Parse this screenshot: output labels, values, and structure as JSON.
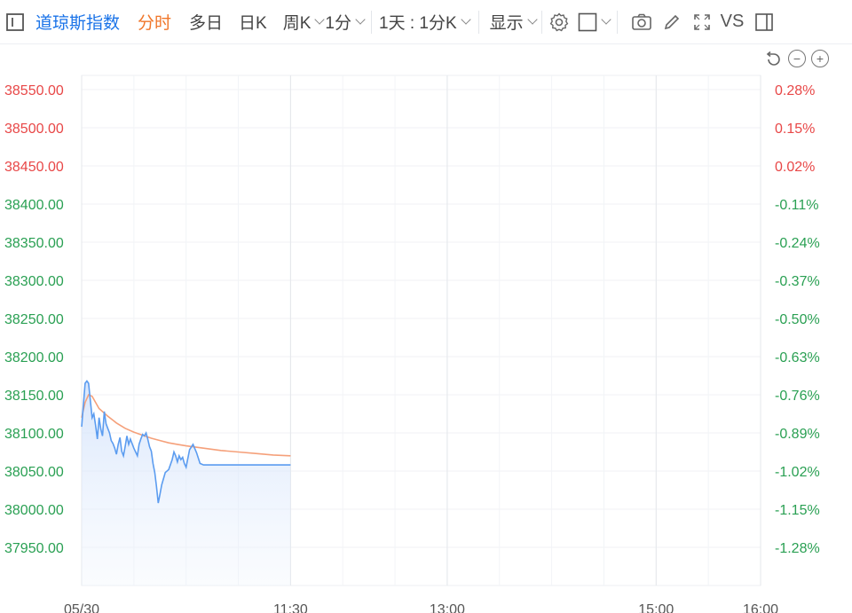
{
  "toolbar": {
    "symbol": "道琼斯指数",
    "tabs": [
      {
        "label": "分时",
        "active": true
      },
      {
        "label": "多日",
        "active": false
      },
      {
        "label": "日K",
        "active": false
      },
      {
        "label": "周K",
        "active": false
      }
    ],
    "interval": "1分",
    "range": "1天 : 1分K",
    "display": "显示",
    "vs": "VS"
  },
  "colors": {
    "accent": "#1a73e8",
    "active_tab": "#f0762a",
    "up": "#e84747",
    "down": "#2aa053",
    "price_line": "#5b9cf0",
    "avg_line": "#f5a07a"
  },
  "chart_data": {
    "type": "line",
    "y_left_ticks": [
      "38550.00",
      "38500.00",
      "38450.00",
      "38400.00",
      "38350.00",
      "38300.00",
      "38250.00",
      "38200.00",
      "38150.00",
      "38100.00",
      "38050.00",
      "38000.00",
      "37950.00"
    ],
    "y_right_ticks": [
      "0.28%",
      "0.15%",
      "0.02%",
      "-0.11%",
      "-0.24%",
      "-0.37%",
      "-0.50%",
      "-0.63%",
      "-0.76%",
      "-0.89%",
      "-1.02%",
      "-1.15%",
      "-1.28%"
    ],
    "right_tick_up": [
      true,
      true,
      true,
      false,
      false,
      false,
      false,
      false,
      false,
      false,
      false,
      false,
      false
    ],
    "ylim": [
      37950,
      38550
    ],
    "x_ticks": [
      {
        "label": "05/30",
        "t": 0
      },
      {
        "label": "11:30",
        "t": 120
      },
      {
        "label": "13:00",
        "t": 210
      },
      {
        "label": "15:00",
        "t": 330
      },
      {
        "label": "16:00",
        "t": 390
      }
    ],
    "x_range": [
      0,
      390
    ],
    "series": [
      {
        "role": "price",
        "x": [
          0,
          2,
          3,
          4,
          6,
          7,
          8,
          9,
          10,
          11,
          12,
          13,
          14,
          15,
          16,
          17,
          18,
          19,
          20,
          21,
          22,
          23,
          24,
          25,
          26,
          27,
          28,
          30,
          32,
          33,
          34,
          35,
          36,
          37,
          38,
          39,
          40,
          41,
          42,
          43,
          44,
          45,
          46,
          47,
          48,
          50,
          52,
          53,
          54,
          55,
          56,
          57,
          58,
          59,
          60,
          62,
          64,
          66,
          68,
          70,
          80,
          90,
          100,
          110,
          120
        ],
        "y": [
          38108,
          38165,
          38168,
          38165,
          38120,
          38125,
          38110,
          38092,
          38120,
          38105,
          38096,
          38128,
          38112,
          38106,
          38100,
          38090,
          38086,
          38080,
          38072,
          38085,
          38094,
          38076,
          38070,
          38082,
          38096,
          38085,
          38092,
          38080,
          38070,
          38085,
          38092,
          38098,
          38096,
          38100,
          38092,
          38082,
          38076,
          38060,
          38048,
          38030,
          38008,
          38020,
          38032,
          38040,
          38048,
          38052,
          38065,
          38075,
          38070,
          38062,
          38070,
          38065,
          38068,
          38060,
          38055,
          38078,
          38085,
          38074,
          38060,
          38058,
          38058,
          38058,
          38058,
          38058,
          38058
        ]
      },
      {
        "role": "avg",
        "x": [
          0,
          2,
          4,
          6,
          8,
          10,
          15,
          20,
          25,
          30,
          35,
          40,
          45,
          50,
          55,
          60,
          70,
          80,
          90,
          100,
          110,
          120
        ],
        "y": [
          38120,
          38140,
          38150,
          38148,
          38140,
          38132,
          38122,
          38113,
          38106,
          38101,
          38097,
          38093,
          38090,
          38087,
          38085,
          38083,
          38080,
          38077,
          38075,
          38073,
          38071,
          38070
        ]
      }
    ]
  }
}
